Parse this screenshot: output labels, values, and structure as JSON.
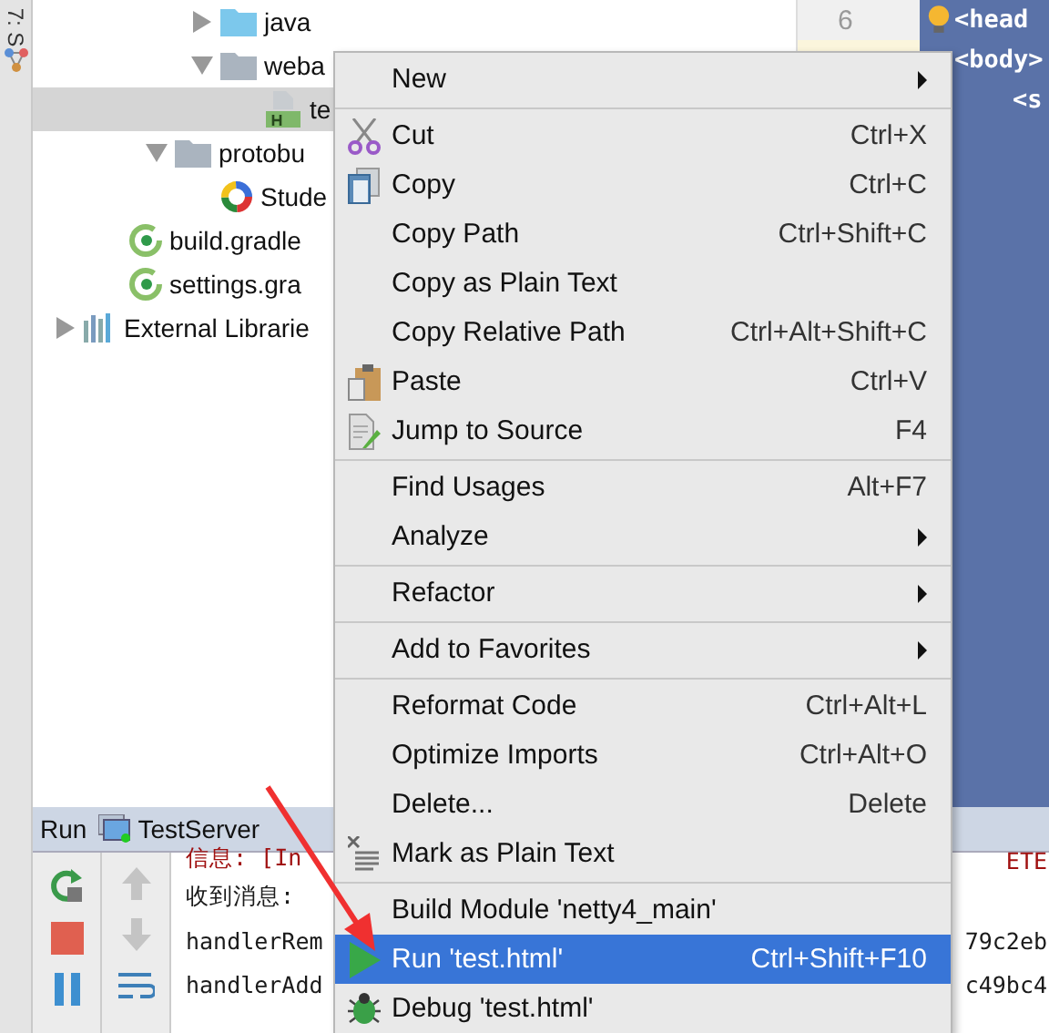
{
  "left_stripe": {
    "label": "7: S"
  },
  "project_tree": [
    {
      "children": [
        {
          "children": [
            {
              "children": [
                {
                  "label": "java",
                  "kind": "source-folder",
                  "expanded": false,
                  "selected": false
                },
                {
                  "label": "weba",
                  "kind": "folder",
                  "expanded": true,
                  "selected": false,
                  "children": [
                    {
                      "label": "te",
                      "kind": "html-file",
                      "selected": true
                    }
                  ]
                }
              ]
            },
            {
              "label": "protobu",
              "kind": "folder",
              "expanded": true,
              "selected": false,
              "children": [
                {
                  "label": "Stude",
                  "kind": "proto-file",
                  "selected": false
                }
              ]
            }
          ]
        },
        {
          "label": "build.gradle",
          "kind": "gradle-file",
          "selected": false
        },
        {
          "label": "settings.gra",
          "kind": "gradle-file",
          "selected": false
        }
      ]
    },
    {
      "label": "External Librarie",
      "kind": "library",
      "expanded": false,
      "selected": false
    }
  ],
  "editor": {
    "lines": [
      {
        "number": "6",
        "code": "<head",
        "current": false,
        "kind": "top"
      },
      {
        "code": "<body>",
        "current": true,
        "kind": "top"
      },
      {
        "code": "<s",
        "kind": "nested"
      }
    ]
  },
  "run_panel": {
    "title": "Run",
    "tab": "TestServer",
    "console": [
      {
        "text": "信息: [In",
        "text_end": "ETE",
        "kind": "error"
      },
      {
        "text": "收到消息:",
        "kind": "normal"
      },
      {
        "text": "handlerRem",
        "text_end": "79c2eb",
        "kind": "normal"
      },
      {
        "text": "handlerAdd",
        "text_end": "c49bc4",
        "kind": "normal"
      }
    ]
  },
  "context_menu": {
    "groups": [
      [
        {
          "label": "New",
          "kind": "plain",
          "submenu": true,
          "selected": false
        }
      ],
      [
        {
          "label": "Cut",
          "shortcut": "Ctrl+X",
          "kind": "cut",
          "selected": false
        },
        {
          "label": "Copy",
          "shortcut": "Ctrl+C",
          "kind": "copy",
          "selected": false
        },
        {
          "label": "Copy Path",
          "shortcut": "Ctrl+Shift+C",
          "kind": "plain",
          "selected": false
        },
        {
          "label": "Copy as Plain Text",
          "kind": "plain",
          "selected": false
        },
        {
          "label": "Copy Relative Path",
          "shortcut": "Ctrl+Alt+Shift+C",
          "kind": "plain",
          "selected": false
        },
        {
          "label": "Paste",
          "shortcut": "Ctrl+V",
          "kind": "paste",
          "selected": false
        },
        {
          "label": "Jump to Source",
          "shortcut": "F4",
          "kind": "jump",
          "selected": false
        }
      ],
      [
        {
          "label": "Find Usages",
          "shortcut": "Alt+F7",
          "kind": "plain",
          "selected": false
        },
        {
          "label": "Analyze",
          "kind": "plain",
          "submenu": true,
          "selected": false
        }
      ],
      [
        {
          "label": "Refactor",
          "kind": "plain",
          "submenu": true,
          "selected": false
        }
      ],
      [
        {
          "label": "Add to Favorites",
          "kind": "plain",
          "submenu": true,
          "selected": false
        }
      ],
      [
        {
          "label": "Reformat Code",
          "shortcut": "Ctrl+Alt+L",
          "kind": "plain",
          "selected": false
        },
        {
          "label": "Optimize Imports",
          "shortcut": "Ctrl+Alt+O",
          "kind": "plain",
          "selected": false
        },
        {
          "label": "Delete...",
          "shortcut": "Delete",
          "kind": "plain",
          "selected": false
        },
        {
          "label": "Mark as Plain Text",
          "kind": "plain-text",
          "selected": false
        }
      ],
      [
        {
          "label": "Build Module 'netty4_main'",
          "kind": "plain",
          "selected": false
        },
        {
          "label": "Run 'test.html'",
          "shortcut": "Ctrl+Shift+F10",
          "kind": "run",
          "selected": true
        },
        {
          "label": "Debug 'test.html'",
          "kind": "debug",
          "selected": false
        }
      ]
    ]
  }
}
